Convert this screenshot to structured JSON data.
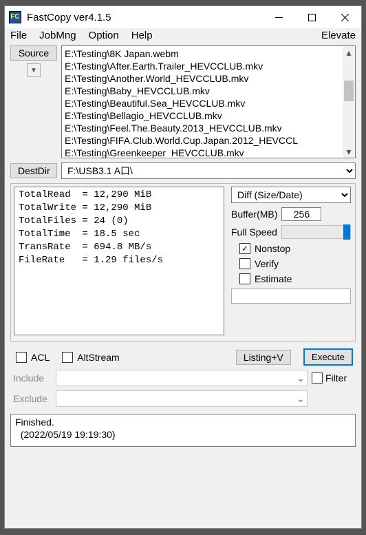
{
  "window": {
    "title": "FastCopy ver4.1.5"
  },
  "menu": {
    "file": "File",
    "jobmng": "JobMng",
    "option": "Option",
    "help": "Help",
    "elevate": "Elevate"
  },
  "labels": {
    "source_btn": "Source",
    "destdir_btn": "DestDir",
    "buffer": "Buffer(MB)",
    "full_speed": "Full Speed",
    "nonstop": "Nonstop",
    "verify": "Verify",
    "estimate": "Estimate",
    "acl": "ACL",
    "altstream": "AltStream",
    "listing": "Listing+V",
    "execute": "Execute",
    "filter": "Filter",
    "include": "Include",
    "exclude": "Exclude"
  },
  "source_files": "E:\\Testing\\8K Japan.webm\nE:\\Testing\\After.Earth.Trailer_HEVCCLUB.mkv\nE:\\Testing\\Another.World_HEVCCLUB.mkv\nE:\\Testing\\Baby_HEVCCLUB.mkv\nE:\\Testing\\Beautiful.Sea_HEVCCLUB.mkv\nE:\\Testing\\Bellagio_HEVCCLUB.mkv\nE:\\Testing\\Feel.The.Beauty.2013_HEVCCLUB.mkv\nE:\\Testing\\FIFA.Club.World.Cup.Japan.2012_HEVCCL\nE:\\Testing\\Greenkeeper_HEVCCLUB.mkv",
  "dest_dir": "F:\\USB3.1 A口\\",
  "mode_selected": "Diff (Size/Date)",
  "buffer_value": "256",
  "stats": "TotalRead  = 12,290 MiB\nTotalWrite = 12,290 MiB\nTotalFiles = 24 (0)\nTotalTime  = 18.5 sec\nTransRate  = 694.8 MB/s\nFileRate   = 1.29 files/s",
  "checks": {
    "nonstop": true,
    "verify": false,
    "estimate": false,
    "acl": false,
    "altstream": false,
    "filter": false
  },
  "status": "Finished.\n  (2022/05/19 19:19:30)"
}
